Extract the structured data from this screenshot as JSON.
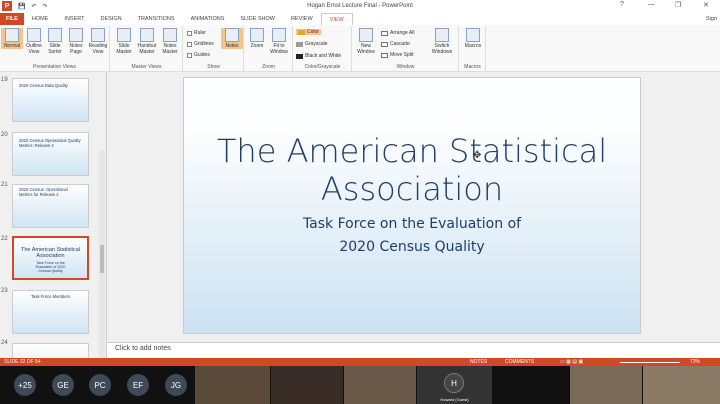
{
  "titlebar": {
    "title": "Hogan Ernst Lecture Final - PowerPoint",
    "logo": "P",
    "controls": [
      "?",
      "—",
      "❐",
      "✕"
    ]
  },
  "tabs": {
    "file": "FILE",
    "items": [
      "HOME",
      "INSERT",
      "DESIGN",
      "TRANSITIONS",
      "ANIMATIONS",
      "SLIDE SHOW",
      "REVIEW",
      "VIEW"
    ],
    "active": "VIEW",
    "signin": "Sign"
  },
  "ribbon": {
    "presentation_views": {
      "label": "Presentation Views",
      "buttons": [
        "Normal",
        "Outline View",
        "Slide Sorter",
        "Notes Page",
        "Reading View"
      ]
    },
    "master_views": {
      "label": "Master Views",
      "buttons": [
        "Slide Master",
        "Handout Master",
        "Notes Master"
      ]
    },
    "show": {
      "label": "Show",
      "checks": [
        "Ruler",
        "Gridlines",
        "Guides"
      ],
      "notes": "Notes"
    },
    "zoom": {
      "label": "Zoom",
      "buttons": [
        "Zoom",
        "Fit to Window"
      ]
    },
    "color": {
      "label": "Color/Grayscale",
      "items": [
        "Color",
        "Grayscale",
        "Black and White"
      ],
      "colors": [
        "#f0a030",
        "#9a9a9a",
        "#222222"
      ]
    },
    "window": {
      "label": "Window",
      "new_window": "New Window",
      "items": [
        "Arrange All",
        "Cascade",
        "Move Split"
      ],
      "switch": "Switch Windows"
    },
    "macros": {
      "label": "Macros",
      "button": "Macros"
    }
  },
  "thumbnails": [
    {
      "num": "19",
      "title": "2020 Census Data Quality"
    },
    {
      "num": "20",
      "title": "2020 Census Operational Quality Metrics: Release 2"
    },
    {
      "num": "21",
      "title": "2020 Census: Operational Metrics for Release 2"
    },
    {
      "num": "22",
      "title": "The American Statistical Association",
      "sub": "Task Force on the Evaluation of 2020 Census Quality"
    },
    {
      "num": "23",
      "title": "Task Force Members"
    },
    {
      "num": "24",
      "title": ""
    }
  ],
  "slide": {
    "title_line1": "The American Statistical",
    "title_line2": "Association",
    "sub_line1": "Task Force on the Evaluation of",
    "sub_line2": "2020 Census Quality"
  },
  "notes_placeholder": "Click to add notes",
  "status": {
    "slide": "SLIDE 22 OF 54",
    "notes": "NOTES",
    "comments": "COMMENTS",
    "zoom": "73%"
  },
  "participants": {
    "avatars": [
      "+25",
      "GE",
      "PC",
      "EF",
      "JG"
    ],
    "tile_initial": "H",
    "tile_name": "Howard (Guest)"
  }
}
